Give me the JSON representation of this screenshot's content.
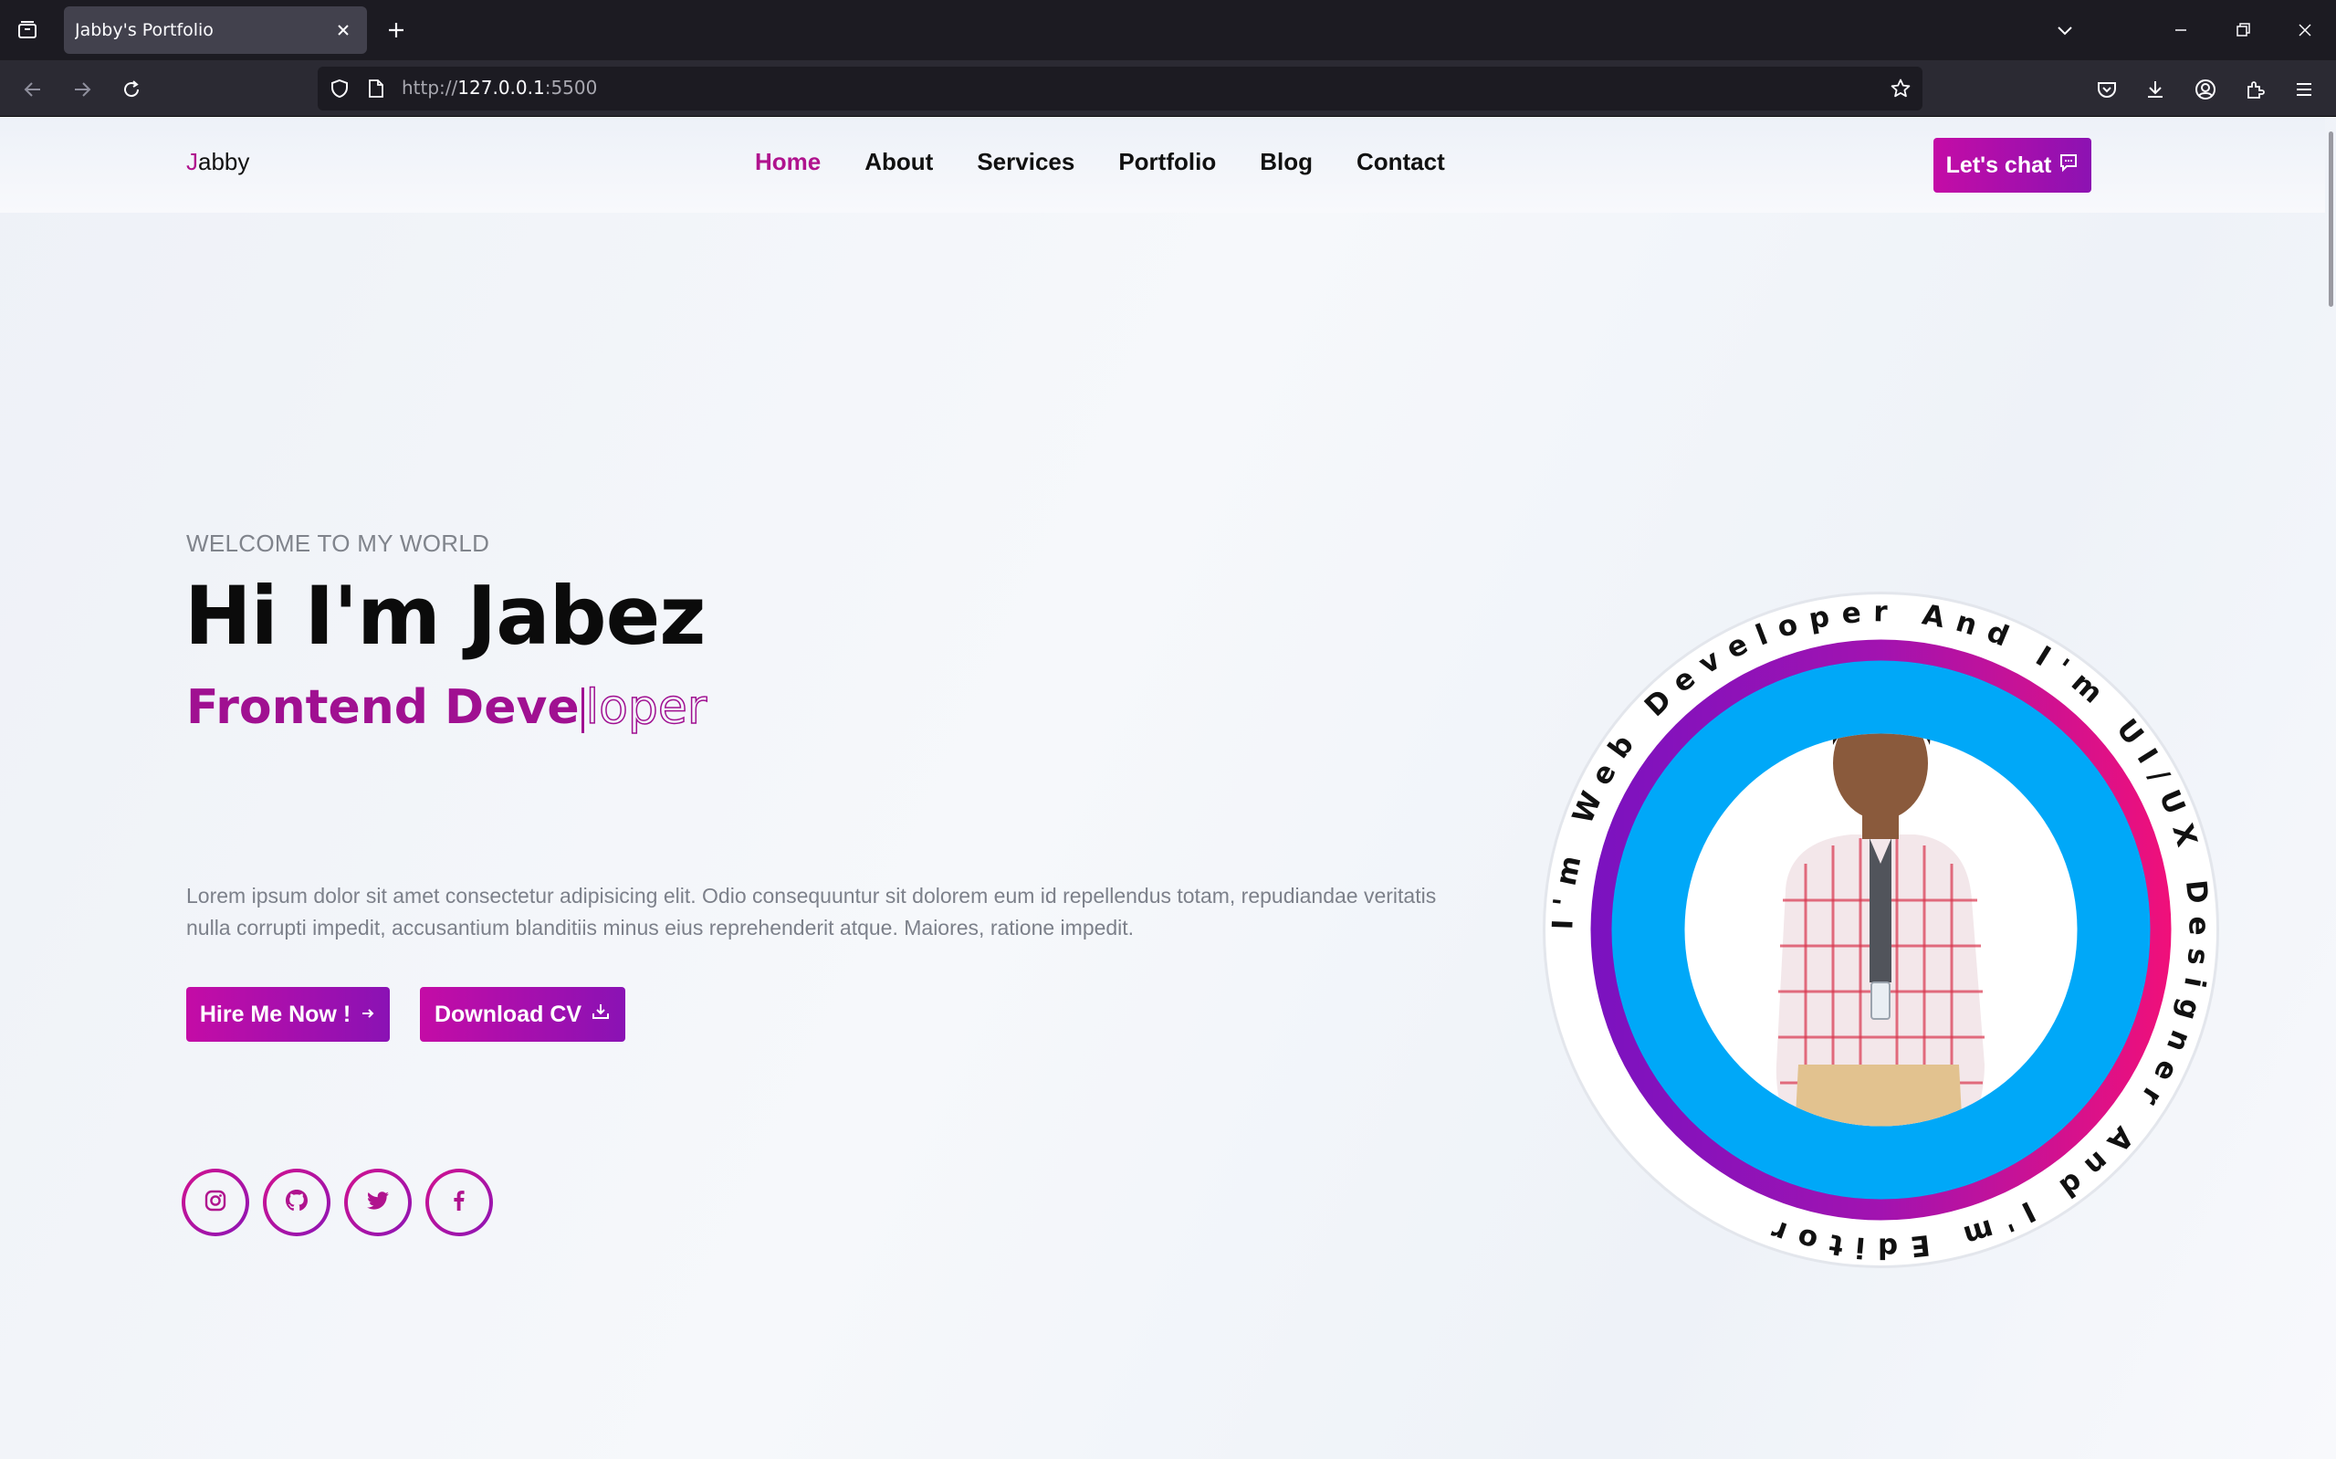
{
  "browser": {
    "tab_title": "Jabby's Portfolio",
    "url_scheme": "http://",
    "url_host": "127.0.0.1",
    "url_port": ":5500"
  },
  "site": {
    "logo_first": "J",
    "logo_rest": "abby",
    "menu": [
      {
        "label": "Home",
        "active": true
      },
      {
        "label": "About",
        "active": false
      },
      {
        "label": "Services",
        "active": false
      },
      {
        "label": "Portfolio",
        "active": false
      },
      {
        "label": "Blog",
        "active": false
      },
      {
        "label": "Contact",
        "active": false
      }
    ],
    "chat_label": "Let's chat"
  },
  "hero": {
    "welcome": "WELCOME TO MY WORLD",
    "title": "Hi I'm Jabez",
    "role_typed": "Frontend Deve",
    "role_remaining": "loper",
    "description": "Lorem ipsum dolor sit amet consectetur adipisicing elit. Odio consequuntur sit dolorem eum id repellendus totam, repudiandae veritatis nulla corrupti impedit, accusantium blanditiis minus eius reprehenderit atque. Maiores, ratione impedit.",
    "hire_label": "Hire Me Now !",
    "cv_label": "Download CV",
    "circle_text": "I'm Web Developer And I'm UI/UX Designer And I'm Editor",
    "social": [
      {
        "name": "instagram-icon"
      },
      {
        "name": "github-icon"
      },
      {
        "name": "twitter-icon"
      },
      {
        "name": "facebook-icon"
      }
    ]
  },
  "colors": {
    "accent": "#b0138e",
    "accent_purple": "#8c12b2",
    "circle_blue": "#00a8f8",
    "browser_dark": "#1c1b22"
  }
}
